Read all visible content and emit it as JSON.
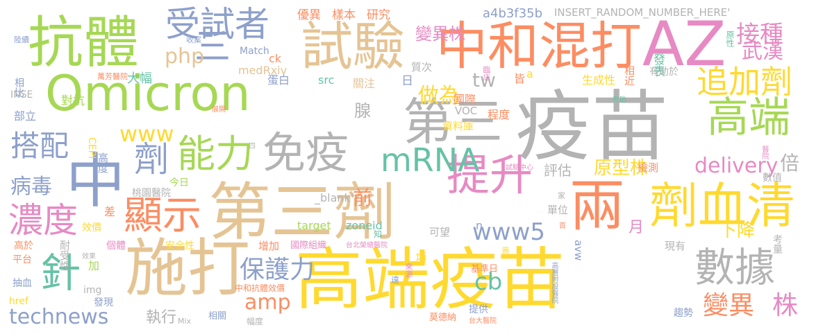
{
  "colors": {
    "green": "#a6d854",
    "orange": "#fc8d62",
    "blue": "#8da0cb",
    "pink": "#e78ac3",
    "yellow": "#ffd92f",
    "tan": "#e5c494",
    "gray": "#b3b3b3",
    "teal": "#66c2a5"
  },
  "words": [
    {
      "text": "疫苗",
      "color": "gray"
    },
    {
      "text": "高端疫苗",
      "color": "yellow"
    },
    {
      "text": "Omicron",
      "color": "green"
    },
    {
      "text": "第三劑",
      "color": "tan"
    },
    {
      "text": "中和混打",
      "color": "orange"
    },
    {
      "text": "抗體",
      "color": "green"
    },
    {
      "text": "試驗",
      "color": "tan"
    },
    {
      "text": "AZ",
      "color": "pink"
    },
    {
      "text": "施打",
      "color": "tan"
    },
    {
      "text": "兩",
      "color": "orange"
    },
    {
      "text": "劑血清",
      "color": "yellow"
    },
    {
      "text": "第三",
      "color": "gray"
    },
    {
      "text": "高端",
      "color": "green"
    },
    {
      "text": "中",
      "color": "blue"
    },
    {
      "text": "顯示",
      "color": "orange"
    },
    {
      "text": "免疫",
      "color": "gray"
    },
    {
      "text": "能力",
      "color": "green"
    },
    {
      "text": "提升",
      "color": "pink"
    },
    {
      "text": "數據",
      "color": "gray"
    },
    {
      "text": "追加劑",
      "color": "yellow"
    },
    {
      "text": "受試者",
      "color": "blue"
    },
    {
      "text": "三",
      "color": "blue"
    },
    {
      "text": "mRNA",
      "color": "teal"
    },
    {
      "text": "搭配",
      "color": "blue"
    },
    {
      "text": "劑",
      "color": "blue"
    },
    {
      "text": "接種",
      "color": "pink"
    },
    {
      "text": "濃度",
      "color": "pink"
    },
    {
      "text": "針",
      "color": "teal"
    },
    {
      "text": "變異",
      "color": "orange"
    },
    {
      "text": "株",
      "color": "pink"
    },
    {
      "text": "www5",
      "color": "blue"
    },
    {
      "text": "technews",
      "color": "blue"
    },
    {
      "text": "保護力",
      "color": "blue"
    },
    {
      "text": "amp",
      "color": "orange"
    },
    {
      "text": "delivery",
      "color": "pink"
    },
    {
      "text": "病毒",
      "color": "blue"
    },
    {
      "text": "www",
      "color": "yellow"
    },
    {
      "text": "做為",
      "color": "yellow"
    },
    {
      "text": "武漢",
      "color": "pink"
    },
    {
      "text": "原型株",
      "color": "yellow"
    },
    {
      "text": "倍",
      "color": "gray"
    },
    {
      "text": "下降",
      "color": "yellow"
    },
    {
      "text": "php",
      "color": "tan"
    },
    {
      "text": "tw",
      "color": "gray"
    },
    {
      "text": "cb",
      "color": "teal"
    },
    {
      "text": "前",
      "color": "orange"
    },
    {
      "text": "月",
      "color": "pink"
    },
    {
      "text": "腺",
      "color": "gray"
    },
    {
      "text": "評估",
      "color": "gray"
    },
    {
      "text": "執行",
      "color": "gray"
    },
    {
      "text": "變異株",
      "color": "pink"
    },
    {
      "text": "優異",
      "color": "orange"
    },
    {
      "text": "樣本",
      "color": "orange"
    },
    {
      "text": "研究",
      "color": "orange"
    },
    {
      "text": "a4b3f35b",
      "color": "blue"
    },
    {
      "text": "INSERT_RANDOM_NUMBER_HERE'",
      "color": "gray"
    },
    {
      "text": "發表",
      "color": "teal"
    },
    {
      "text": "原性",
      "color": "teal"
    },
    {
      "text": "相近",
      "color": "orange"
    },
    {
      "text": "medRxiv",
      "color": "tan"
    },
    {
      "text": "大幅",
      "color": "teal"
    },
    {
      "text": "ck",
      "color": "orange"
    },
    {
      "text": "Match",
      "color": "blue"
    },
    {
      "text": "收案",
      "color": "blue"
    },
    {
      "text": "陸續",
      "color": "blue"
    },
    {
      "text": "src",
      "color": "teal"
    },
    {
      "text": "蛋白",
      "color": "blue"
    },
    {
      "text": "關注",
      "color": "tan"
    },
    {
      "text": "日",
      "color": "blue"
    },
    {
      "text": "質次",
      "color": "gray"
    },
    {
      "text": "皆",
      "color": "orange"
    },
    {
      "text": "a",
      "color": "yellow"
    },
    {
      "text": "臨床",
      "color": "pink"
    },
    {
      "text": "生成性",
      "color": "yellow"
    },
    {
      "text": "有助於",
      "color": "gray"
    },
    {
      "text": "萬芳醫院",
      "color": "orange"
    },
    {
      "text": "相比",
      "color": "blue"
    },
    {
      "text": "INSE",
      "color": "gray"
    },
    {
      "text": "對抗",
      "color": "green"
    },
    {
      "text": "部立",
      "color": "blue"
    },
    {
      "text": "國際",
      "color": "orange"
    },
    {
      "text": "VOC",
      "color": "gray"
    },
    {
      "text": "程度",
      "color": "orange"
    },
    {
      "text": "資料庫",
      "color": "yellow"
    },
    {
      "text": "展開",
      "color": "orange"
    },
    {
      "text": "有助",
      "color": "teal"
    },
    {
      "text": "醫院",
      "color": "pink"
    },
    {
      "text": "CEPI",
      "color": "yellow"
    },
    {
      "text": "高度",
      "color": "blue"
    },
    {
      "text": "四",
      "color": "gray"
    },
    {
      "text": "試驗中心",
      "color": "pink"
    },
    {
      "text": "檢測",
      "color": "orange"
    },
    {
      "text": "數值",
      "color": "gray"
    },
    {
      "text": "桃園醫院",
      "color": "gray"
    },
    {
      "text": "今日",
      "color": "green"
    },
    {
      "text": "家",
      "color": "gray"
    },
    {
      "text": "_blank'",
      "color": "gray"
    },
    {
      "text": "單位",
      "color": "gray"
    },
    {
      "text": "差",
      "color": "orange"
    },
    {
      "text": "target",
      "color": "green"
    },
    {
      "text": "zoneid",
      "color": "teal"
    },
    {
      "text": "n",
      "color": "blue"
    },
    {
      "text": "首",
      "color": "orange"
    },
    {
      "text": "效價",
      "color": "yellow"
    },
    {
      "text": "可望",
      "color": "gray"
    },
    {
      "text": "耐受性",
      "color": "gray"
    },
    {
      "text": "高於",
      "color": "orange"
    },
    {
      "text": "個體",
      "color": "pink"
    },
    {
      "text": "安全性",
      "color": "yellow"
    },
    {
      "text": "增加",
      "color": "orange"
    },
    {
      "text": "國際組織",
      "color": "pink"
    },
    {
      "text": "台北榮總醫院",
      "color": "pink"
    },
    {
      "text": "知",
      "color": "teal"
    },
    {
      "text": "avw",
      "color": "blue"
    },
    {
      "text": "現有",
      "color": "gray"
    },
    {
      "text": "考量",
      "color": "gray"
    },
    {
      "text": "效果",
      "color": "gray"
    },
    {
      "text": "平台",
      "color": "orange"
    },
    {
      "text": "加",
      "color": "green"
    },
    {
      "text": "項",
      "color": "yellow"
    },
    {
      "text": "圖",
      "color": "yellow"
    },
    {
      "text": "抽血",
      "color": "blue"
    },
    {
      "text": "img",
      "color": "gray"
    },
    {
      "text": "中和抗體效價",
      "color": "orange"
    },
    {
      "text": "來源",
      "color": "pink"
    },
    {
      "text": "基準日",
      "color": "orange"
    },
    {
      "text": "遠",
      "color": "blue"
    },
    {
      "text": "高層附設醫院",
      "color": "blue"
    },
    {
      "text": "href",
      "color": "yellow"
    },
    {
      "text": "發現",
      "color": "blue"
    },
    {
      "text": "提供",
      "color": "blue"
    },
    {
      "text": "趨勢",
      "color": "blue"
    },
    {
      "text": "Mix",
      "color": "gray"
    },
    {
      "text": "相關",
      "color": "blue"
    },
    {
      "text": "幅度",
      "color": "gray"
    },
    {
      "text": "莫德納",
      "color": "orange"
    },
    {
      "text": "台大醫院",
      "color": "orange"
    }
  ]
}
